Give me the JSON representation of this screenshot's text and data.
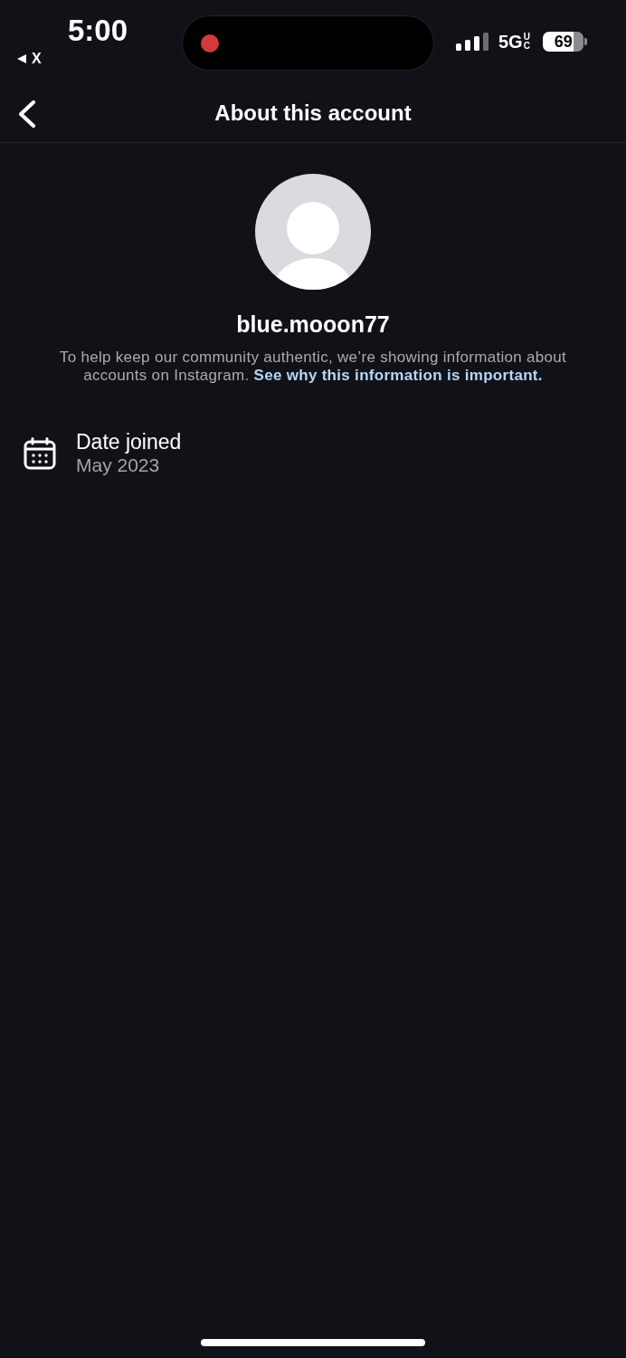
{
  "status_bar": {
    "time": "5:00",
    "back_link": "X",
    "recording": true,
    "network": "5G",
    "network_badge": "UC",
    "battery": "69"
  },
  "header": {
    "title": "About this account"
  },
  "profile": {
    "username": "blue.mooon77",
    "description": "To help keep our community authentic, we’re showing information about accounts on Instagram.",
    "link": "See why this information is important."
  },
  "details": [
    {
      "kind": "date",
      "label": "Date joined",
      "value": "May 2023"
    }
  ]
}
